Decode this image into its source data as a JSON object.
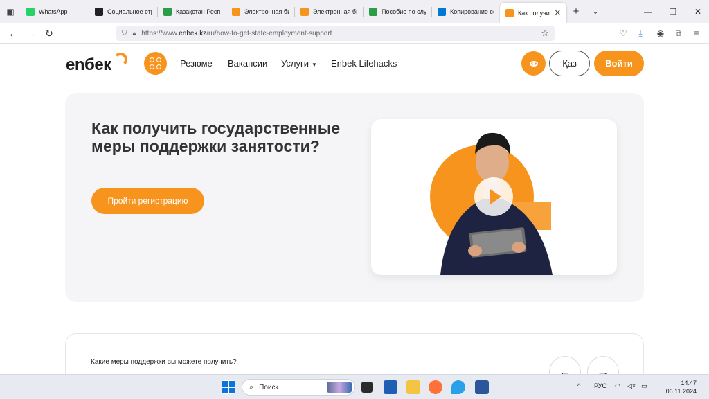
{
  "browser": {
    "tabs": [
      {
        "title": "WhatsApp",
        "favicon": "whatsapp-icon",
        "color": "#25d366"
      },
      {
        "title": "Социальное стр",
        "favicon": "kp-icon",
        "color": "#222222"
      },
      {
        "title": "Қазақстан Респ",
        "favicon": "egov-icon",
        "color": "#2a9d46"
      },
      {
        "title": "Электронная би",
        "favicon": "enbek-icon",
        "color": "#f7941d"
      },
      {
        "title": "Электронная би",
        "favicon": "enbek-icon",
        "color": "#f7941d"
      },
      {
        "title": "Пособие по слу",
        "favicon": "egov-icon",
        "color": "#2a9d46"
      },
      {
        "title": "Копирование со",
        "favicon": "microsoft-icon",
        "color": "#0078d4"
      },
      {
        "title": "Как получить",
        "favicon": "enbek-icon",
        "color": "#f7941d",
        "active": true
      }
    ],
    "url_prefix": "https://www.",
    "url_host": "enbek.kz",
    "url_path": "/ru/how-to-get-state-employment-support"
  },
  "site": {
    "logo": "enбек",
    "nav": [
      "Резюме",
      "Вакансии",
      "Услуги",
      "Enbek Lifehacks"
    ],
    "lang_button": "Қаз",
    "login_button": "Войти",
    "brand_color": "#f7941d"
  },
  "hero": {
    "title": "Как получить государственные меры поддержки занятости?",
    "cta": "Пройти регистрацию"
  },
  "support": {
    "question": "Какие меры поддержки вы можете получить?"
  },
  "taskbar": {
    "search_placeholder": "Поиск",
    "language": "РУС",
    "time": "14:47",
    "date": "06.11.2024"
  }
}
